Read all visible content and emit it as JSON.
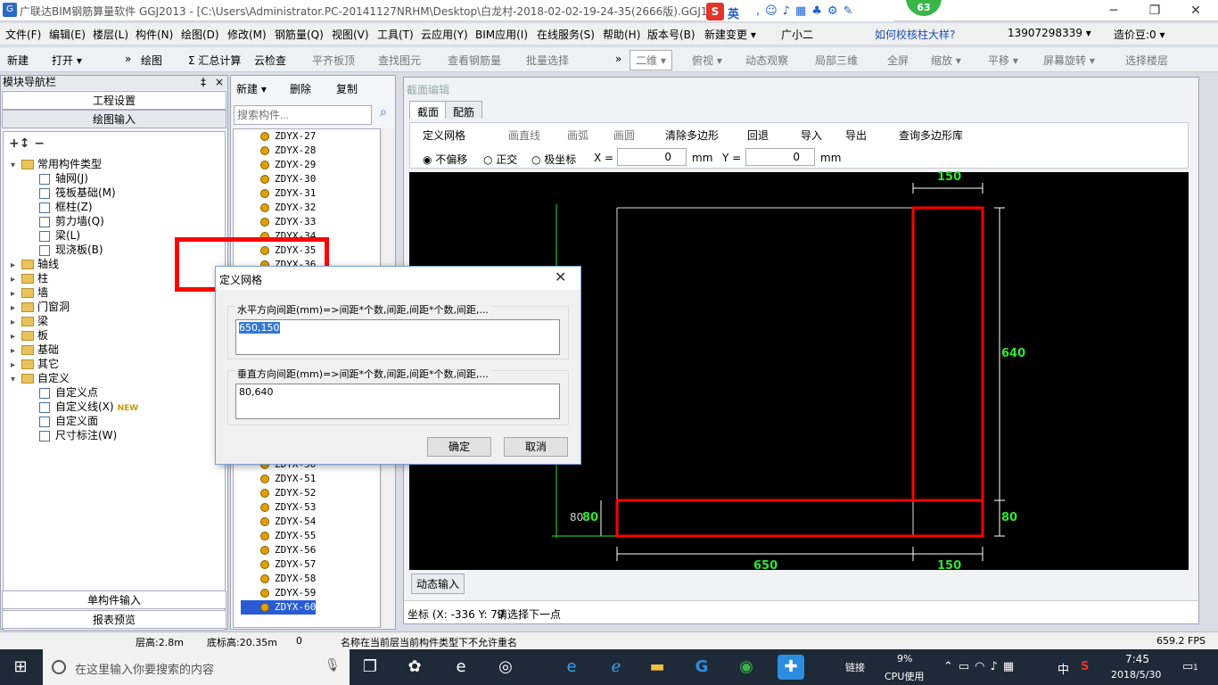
{
  "window": {
    "title": "广联达BIM钢筋算量软件 GGJ2013 - [C:\\Users\\Administrator.PC-20141127NRHM\\Desktop\\白龙村-2018-02-02-19-24-35(2666版).GGJ12]",
    "minimize": "─",
    "maximize": "❐",
    "close": "✕"
  },
  "ime": {
    "s": "S",
    "lang": "英",
    "badge": "63"
  },
  "menu": [
    "文件(F)",
    "编辑(E)",
    "楼层(L)",
    "构件(N)",
    "绘图(D)",
    "修改(M)",
    "钢筋量(Q)",
    "视图(V)",
    "工具(T)",
    "云应用(Y)",
    "BIM应用(I)",
    "在线服务(S)",
    "帮助(H)",
    "版本号(B)",
    "新建变更 ▾",
    "广小二",
    "如何校核柱大样?",
    "13907298339 ▾",
    "造价豆:0 ▾"
  ],
  "toolbar": [
    "新建",
    "打开 ▾",
    "»",
    "绘图",
    "Σ 汇总计算",
    "云检查",
    "平齐板顶",
    "查找图元",
    "查看钢筋量",
    "批量选择",
    "»",
    "二维 ▾",
    "俯视 ▾",
    "动态观察",
    "局部三维",
    "全屏",
    "缩放 ▾",
    "平移 ▾",
    "屏幕旋转 ▾",
    "选择楼层"
  ],
  "left_panel": {
    "header": "模块导航栏",
    "pin": "‡",
    "close": "×",
    "btn_project": "工程设置",
    "btn_draw": "绘图输入",
    "btn_single": "单构件输入",
    "btn_report": "报表预览",
    "tree": [
      {
        "label": "常用构件类型",
        "level": 0,
        "expand": "▾"
      },
      {
        "label": "轴网(J)",
        "level": 1,
        "expand": ""
      },
      {
        "label": "筏板基础(M)",
        "level": 1,
        "expand": ""
      },
      {
        "label": "框柱(Z)",
        "level": 1,
        "expand": ""
      },
      {
        "label": "剪力墙(Q)",
        "level": 1,
        "expand": ""
      },
      {
        "label": "梁(L)",
        "level": 1,
        "expand": ""
      },
      {
        "label": "现浇板(B)",
        "level": 1,
        "expand": ""
      },
      {
        "label": "轴线",
        "level": 0,
        "expand": "▸"
      },
      {
        "label": "柱",
        "level": 0,
        "expand": "▸"
      },
      {
        "label": "墙",
        "level": 0,
        "expand": "▸"
      },
      {
        "label": "门窗洞",
        "level": 0,
        "expand": "▸"
      },
      {
        "label": "梁",
        "level": 0,
        "expand": "▸"
      },
      {
        "label": "板",
        "level": 0,
        "expand": "▸"
      },
      {
        "label": "基础",
        "level": 0,
        "expand": "▸"
      },
      {
        "label": "其它",
        "level": 0,
        "expand": "▸"
      },
      {
        "label": "自定义",
        "level": 0,
        "expand": "▾"
      },
      {
        "label": "自定义点",
        "level": 1,
        "expand": ""
      },
      {
        "label": "自定义线(X)",
        "level": 1,
        "expand": ""
      },
      {
        "label": "自定义面",
        "level": 1,
        "expand": ""
      },
      {
        "label": "尺寸标注(W)",
        "level": 1,
        "expand": ""
      }
    ],
    "new_badge": "NEW"
  },
  "list_panel": {
    "toolbar": [
      "新建 ▾",
      "删除",
      "复制"
    ],
    "search_placeholder": "搜索构件...",
    "items_top": [
      "ZDYX-27",
      "ZDYX-28",
      "ZDYX-29",
      "ZDYX-30",
      "ZDYX-31",
      "ZDYX-32",
      "ZDYX-33",
      "ZDYX-34",
      "ZDYX-35",
      "ZDYX-36"
    ],
    "items_bottom": [
      "ZDYX-50",
      "ZDYX-51",
      "ZDYX-52",
      "ZDYX-53",
      "ZDYX-54",
      "ZDYX-55",
      "ZDYX-56",
      "ZDYX-57",
      "ZDYX-58",
      "ZDYX-59",
      "ZDYX-60"
    ],
    "selected": "ZDYX-60"
  },
  "editor": {
    "header": "截面编辑",
    "tabs": [
      "截面",
      "配筋"
    ],
    "tools": [
      "定义网格",
      "画直线",
      "画弧",
      "画圆",
      "清除多边形",
      "回退",
      "导入",
      "导出",
      "查询多边形库"
    ],
    "mode_options": [
      "不偏移",
      "正交",
      "极坐标"
    ],
    "x_label": "X =",
    "x_value": "0",
    "y_label": "Y =",
    "y_value": "0",
    "unit": "mm",
    "dim_labels": {
      "top": "150",
      "right": "640",
      "bottom_right": "80",
      "left": "80",
      "left2": "80",
      "bottom_left": "650",
      "bottom_right2": "150"
    },
    "dynamic_input": "动态输入",
    "coord_text": "坐标 (X: -336 Y: 79",
    "prompt_text": "请选择下一点"
  },
  "dialog": {
    "title": "定义网格",
    "h_label": "水平方向间距(mm)=>间距*个数,间距,间距*个数,间距,...",
    "h_value": "650,150",
    "v_label": "垂直方向间距(mm)=>间距*个数,间距,间距*个数,间距,...",
    "v_value": "80,640",
    "ok": "确定",
    "cancel": "取消"
  },
  "status": {
    "floor_h": "层高:2.8m",
    "base_h": "底标高:20.35m",
    "zero": "0",
    "message": "名称在当前层当前构件类型下不允许重名",
    "fps": "659.2 FPS"
  },
  "taskbar": {
    "search_placeholder": "在这里输入你要搜索的内容",
    "link": "链接",
    "cpu": "9%",
    "cpu_label": "CPU使用",
    "ime_lang": "中",
    "time": "7:45",
    "date": "2018/5/30",
    "notif": "1"
  },
  "colors": {
    "accent": "#2a5bd7",
    "grid_green": "#2ee62e",
    "highlight_red": "#ff0000"
  }
}
